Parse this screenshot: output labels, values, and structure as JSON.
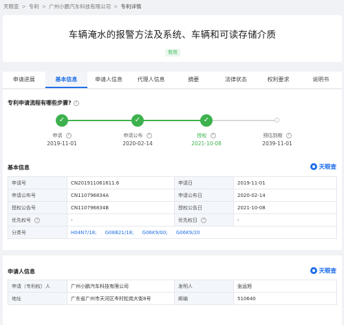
{
  "breadcrumb": {
    "items": [
      "天眼查",
      "专利",
      "广州小鹏汽车科技有限公司",
      "专利详情"
    ],
    "sep": ">"
  },
  "patent": {
    "title": "车辆淹水的报警方法及系统、车辆和可读存储介质",
    "status": "有效"
  },
  "tabs": [
    "申请进展",
    "基本信息",
    "申请人信息",
    "代理人信息",
    "摘要",
    "法律状态",
    "权利要求",
    "说明书"
  ],
  "active_tab": "基本信息",
  "progress": {
    "question": "专利申请流程有哪些步骤?",
    "stages": [
      {
        "label": "申请",
        "date": "2019-11-01",
        "state": "done"
      },
      {
        "label": "申请公布",
        "date": "2020-02-14",
        "state": "done"
      },
      {
        "label": "授权",
        "date": "2021-10-08",
        "state": "current"
      },
      {
        "label": "预估到期",
        "date": "2039-11-01",
        "state": "pending"
      }
    ]
  },
  "basic_info": {
    "title": "基本信息",
    "rows": [
      {
        "l1": "申请号",
        "v1": "CN201911061611.6",
        "l2": "申请日",
        "v2": "2019-11-01"
      },
      {
        "l1": "申请公布号",
        "v1": "CN110796834A",
        "l2": "申请公布日",
        "v2": "2020-02-14"
      },
      {
        "l1": "授权公告号",
        "v1": "CN110796834B",
        "l2": "授权公告日",
        "v2": "2021-10-08"
      },
      {
        "l1": "优先权号",
        "v1": "-",
        "l2": "优先权日",
        "v2": "-"
      }
    ],
    "class_label": "分类号",
    "classes": [
      "H04N7/18;",
      "G08B21/18;",
      "G06K9/00;",
      "G06K9/20"
    ]
  },
  "applicant_info": {
    "title": "申请人信息",
    "rows": [
      {
        "l1": "申请（专利权）人",
        "v1": "广州小鹏汽车科技有限公司",
        "l2": "发明人",
        "v2": "张运旭"
      },
      {
        "l1": "地址",
        "v1": "广东省广州市天河区岑村松岗大街8号",
        "l2": "邮编",
        "v2": "510640"
      }
    ]
  },
  "brand": {
    "logo_text": "天眼查"
  },
  "colors": {
    "accent": "#1e6ee8",
    "success": "#3db14d",
    "label_bg": "#f3f6fb"
  }
}
